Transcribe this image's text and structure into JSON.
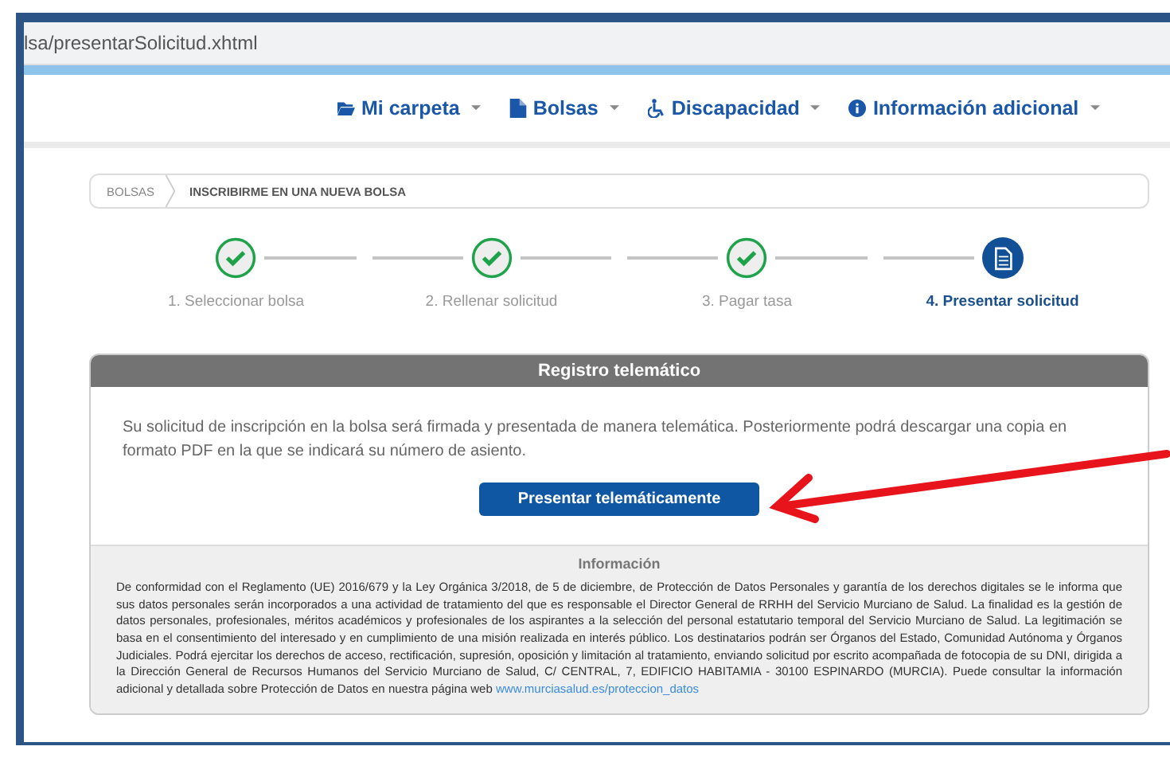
{
  "address_bar": {
    "url": "lsa/presentarSolicitud.xhtml"
  },
  "nav": [
    {
      "label": "Mi carpeta",
      "kind": "folder"
    },
    {
      "label": "Bolsas",
      "kind": "file"
    },
    {
      "label": "Discapacidad",
      "kind": "wheelchair"
    },
    {
      "label": "Información adicional",
      "kind": "info"
    }
  ],
  "breadcrumb": [
    "BOLSAS",
    "INSCRIBIRME EN UNA NUEVA BOLSA"
  ],
  "steps": [
    {
      "label": "1. Seleccionar bolsa",
      "done": true,
      "selected": false
    },
    {
      "label": "2. Rellenar solicitud",
      "done": true,
      "selected": false
    },
    {
      "label": "3. Pagar tasa",
      "done": true,
      "selected": false
    },
    {
      "label": "4. Presentar solicitud",
      "done": false,
      "selected": true
    }
  ],
  "panel": {
    "title": "Registro telemático",
    "message": "Su solicitud de inscripción en la bolsa será firmada y presentada de manera telemática. Posteriormente podrá descargar una copia en formato PDF en la que se indicará su número de asiento.",
    "button": "Presentar telemáticamente",
    "info": {
      "title": "Información",
      "text": "De conformidad con el Reglamento (UE) 2016/679 y la Ley Orgánica 3/2018, de 5 de diciembre, de Protección de Datos Personales y garantía de los derechos digitales se le informa que sus datos personales serán incorporados a una actividad de tratamiento del que es responsable el Director General de RRHH del Servicio Murciano de Salud. La finalidad es la gestión de datos personales, profesionales, méritos académicos y profesionales de los aspirantes a la selección del personal estatutario temporal del Servicio Murciano de Salud. La legitimación se basa en el consentimiento del interesado y en cumplimiento de una misión realizada en interés público. Los destinatarios podrán ser Órganos del Estado, Comunidad Autónoma y Órganos Judiciales. Podrá ejercitar los derechos de acceso, rectificación, supresión, oposición y limitación al tratamiento, enviando solicitud por escrito acompañada de fotocopia de su DNI, dirigida a la Dirección General de Recursos Humanos del Servicio Murciano de Salud, C/ CENTRAL, 7, EDIFICIO HABITAMIA - 30100 ESPINARDO (MURCIA). Puede consultar la información adicional y detallada sobre Protección de Datos en nuestra página web",
      "link": "www.murciasalud.es/proteccion_datos"
    }
  }
}
